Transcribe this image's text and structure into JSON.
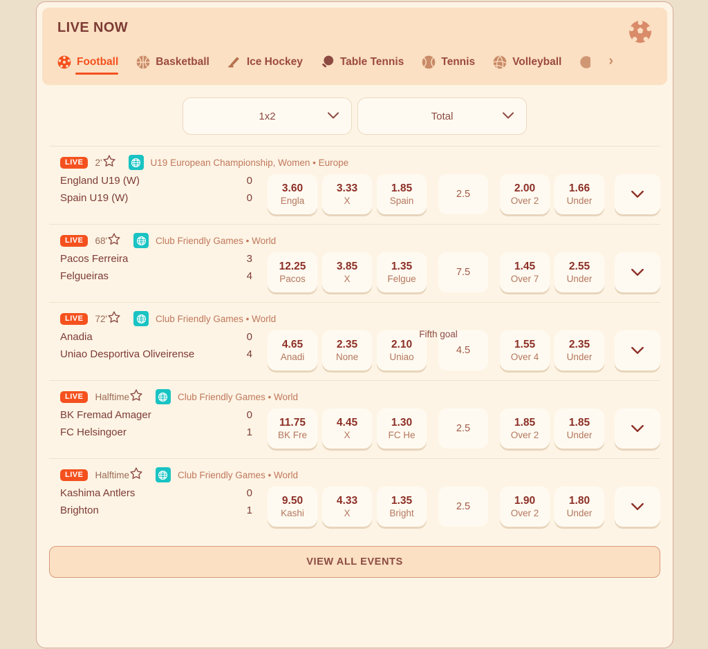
{
  "header": {
    "title": "LIVE NOW",
    "logo_icon": "football-ball-icon",
    "next_arrow": "›",
    "tabs": [
      {
        "label": "Football",
        "icon": "football-icon",
        "active": true
      },
      {
        "label": "Basketball",
        "icon": "basketball-icon",
        "active": false
      },
      {
        "label": "Ice Hockey",
        "icon": "ice-hockey-icon",
        "active": false
      },
      {
        "label": "Table Tennis",
        "icon": "table-tennis-icon",
        "active": false
      },
      {
        "label": "Tennis",
        "icon": "tennis-icon",
        "active": false
      },
      {
        "label": "Volleyball",
        "icon": "volleyball-icon",
        "active": false
      }
    ]
  },
  "filters": [
    {
      "name": "market-1x2",
      "value": "1x2"
    },
    {
      "name": "market-total",
      "value": "Total"
    }
  ],
  "colors": {
    "accent": "#f4511e",
    "brand_text": "#7d3b35",
    "league_text": "#c0785c",
    "globe_badge": "#1ac3c3",
    "card_bg": "#fdf4e5",
    "header_bg": "#fbe0c3",
    "page_bg": "#ece0cb"
  },
  "matches": [
    {
      "status": "LIVE",
      "minute": "2'",
      "league": "U19 European Championship, Women • Europe",
      "submarket": "",
      "home": "England U19 (W)",
      "away": "Spain U19 (W)",
      "home_score": "0",
      "away_score": "0",
      "odds_1x2": [
        {
          "value": "3.60",
          "label": "Engla"
        },
        {
          "value": "3.33",
          "label": "X"
        },
        {
          "value": "1.85",
          "label": "Spain"
        }
      ],
      "total_line": "2.5",
      "odds_total": [
        {
          "value": "2.00",
          "label": "Over 2"
        },
        {
          "value": "1.66",
          "label": "Under"
        }
      ]
    },
    {
      "status": "LIVE",
      "minute": "68'",
      "league": "Club Friendly Games • World",
      "submarket": "",
      "home": "Pacos Ferreira",
      "away": "Felgueiras",
      "home_score": "3",
      "away_score": "4",
      "odds_1x2": [
        {
          "value": "12.25",
          "label": "Pacos"
        },
        {
          "value": "3.85",
          "label": "X"
        },
        {
          "value": "1.35",
          "label": "Felgue"
        }
      ],
      "total_line": "7.5",
      "odds_total": [
        {
          "value": "1.45",
          "label": "Over 7"
        },
        {
          "value": "2.55",
          "label": "Under"
        }
      ]
    },
    {
      "status": "LIVE",
      "minute": "72'",
      "league": "Club Friendly Games • World",
      "submarket": "Fifth goal",
      "home": "Anadia",
      "away": "Uniao Desportiva Oliveirense",
      "home_score": "0",
      "away_score": "4",
      "odds_1x2": [
        {
          "value": "4.65",
          "label": "Anadi"
        },
        {
          "value": "2.35",
          "label": "None"
        },
        {
          "value": "2.10",
          "label": "Uniao"
        }
      ],
      "total_line": "4.5",
      "odds_total": [
        {
          "value": "1.55",
          "label": "Over 4"
        },
        {
          "value": "2.35",
          "label": "Under"
        }
      ]
    },
    {
      "status": "LIVE",
      "minute": "Halftime",
      "league": "Club Friendly Games • World",
      "submarket": "",
      "home": "BK Fremad Amager",
      "away": "FC Helsingoer",
      "home_score": "0",
      "away_score": "1",
      "odds_1x2": [
        {
          "value": "11.75",
          "label": "BK Fre"
        },
        {
          "value": "4.45",
          "label": "X"
        },
        {
          "value": "1.30",
          "label": "FC He"
        }
      ],
      "total_line": "2.5",
      "odds_total": [
        {
          "value": "1.85",
          "label": "Over 2"
        },
        {
          "value": "1.85",
          "label": "Under"
        }
      ]
    },
    {
      "status": "LIVE",
      "minute": "Halftime",
      "league": "Club Friendly Games • World",
      "submarket": "",
      "home": "Kashima Antlers",
      "away": "Brighton",
      "home_score": "0",
      "away_score": "1",
      "odds_1x2": [
        {
          "value": "9.50",
          "label": "Kashi"
        },
        {
          "value": "4.33",
          "label": "X"
        },
        {
          "value": "1.35",
          "label": "Bright"
        }
      ],
      "total_line": "2.5",
      "odds_total": [
        {
          "value": "1.90",
          "label": "Over 2"
        },
        {
          "value": "1.80",
          "label": "Under"
        }
      ]
    }
  ],
  "footer": {
    "view_all_label": "VIEW ALL EVENTS"
  }
}
